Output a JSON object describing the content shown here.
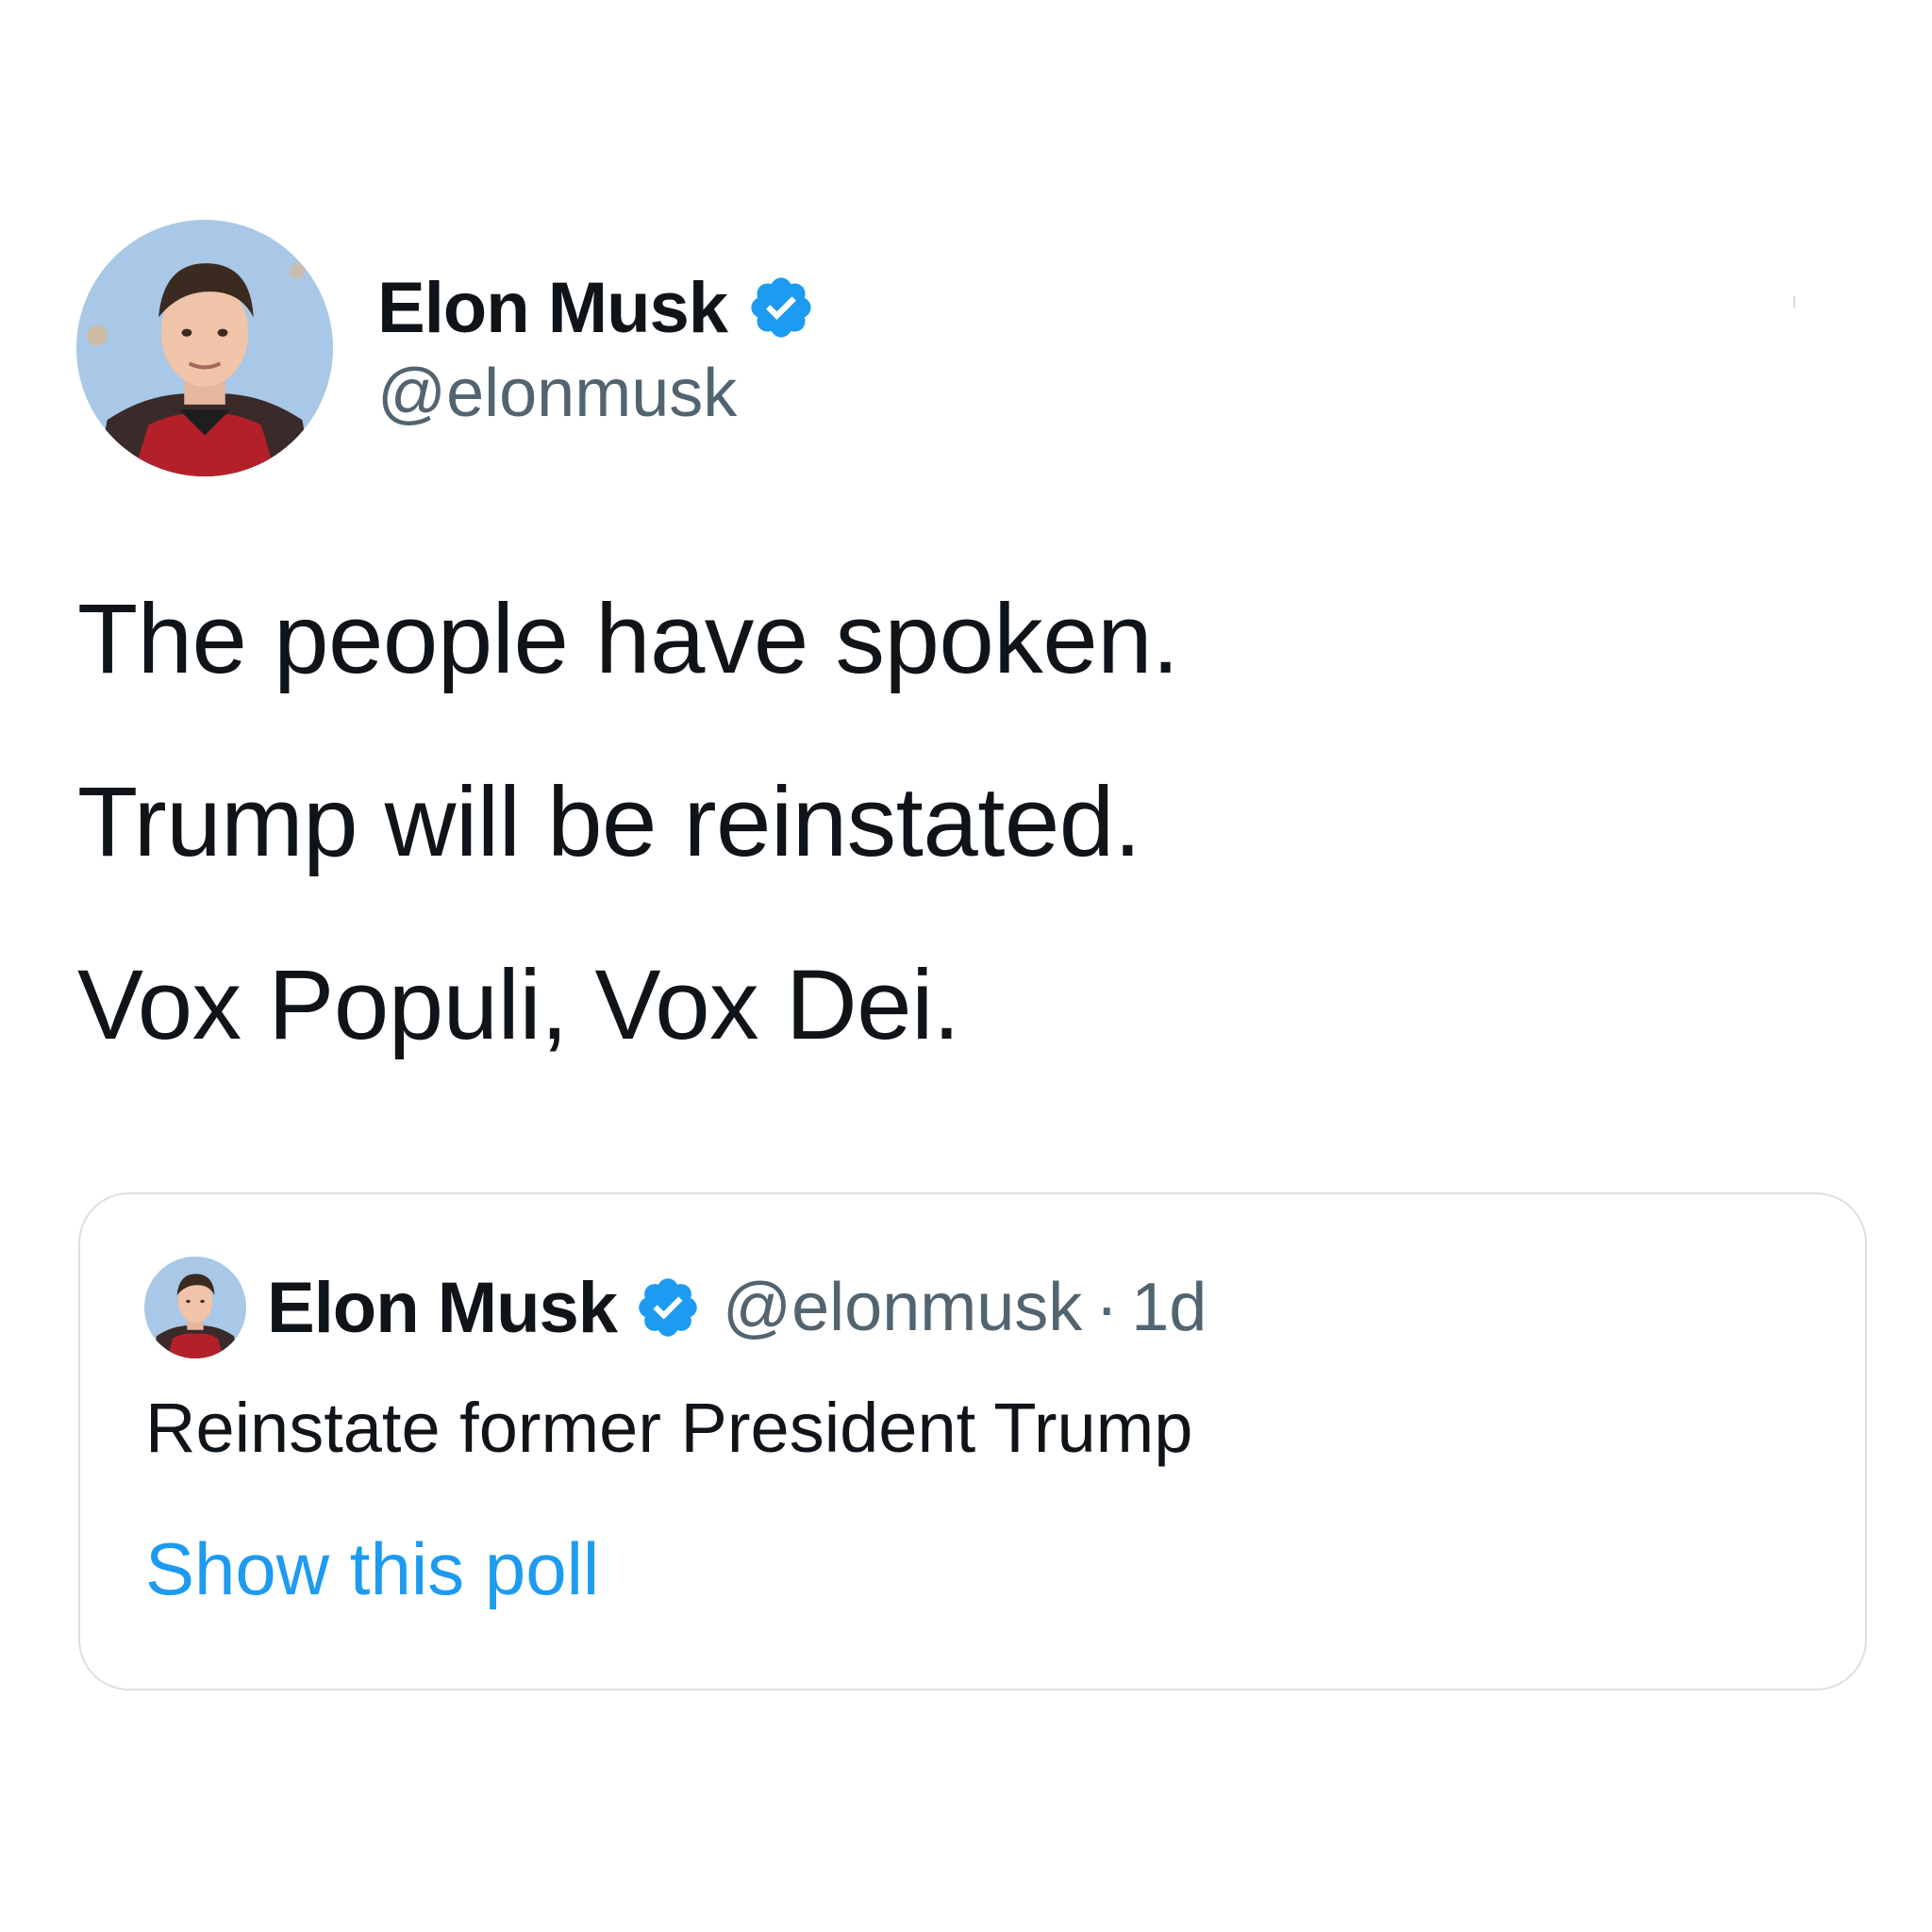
{
  "tweet": {
    "author": {
      "display_name": "Elon Musk",
      "handle": "@elonmusk",
      "verified": true,
      "avatar_icon": "person-avatar"
    },
    "lines": [
      "The people have spoken.",
      "Trump will be reinstated.",
      "Vox Populi, Vox Dei."
    ]
  },
  "quoted": {
    "author": {
      "display_name": "Elon Musk",
      "handle": "@elonmusk",
      "verified": true,
      "avatar_icon": "person-avatar"
    },
    "separator": "·",
    "time": "1d",
    "text": "Reinstate former President Trump",
    "link_label": "Show this poll"
  },
  "colors": {
    "verified_blue": "#1d9bf0",
    "link_blue": "#1d9bf0",
    "secondary_text": "#536471",
    "primary_text": "#0f1419",
    "card_border": "#dcdfe3"
  }
}
